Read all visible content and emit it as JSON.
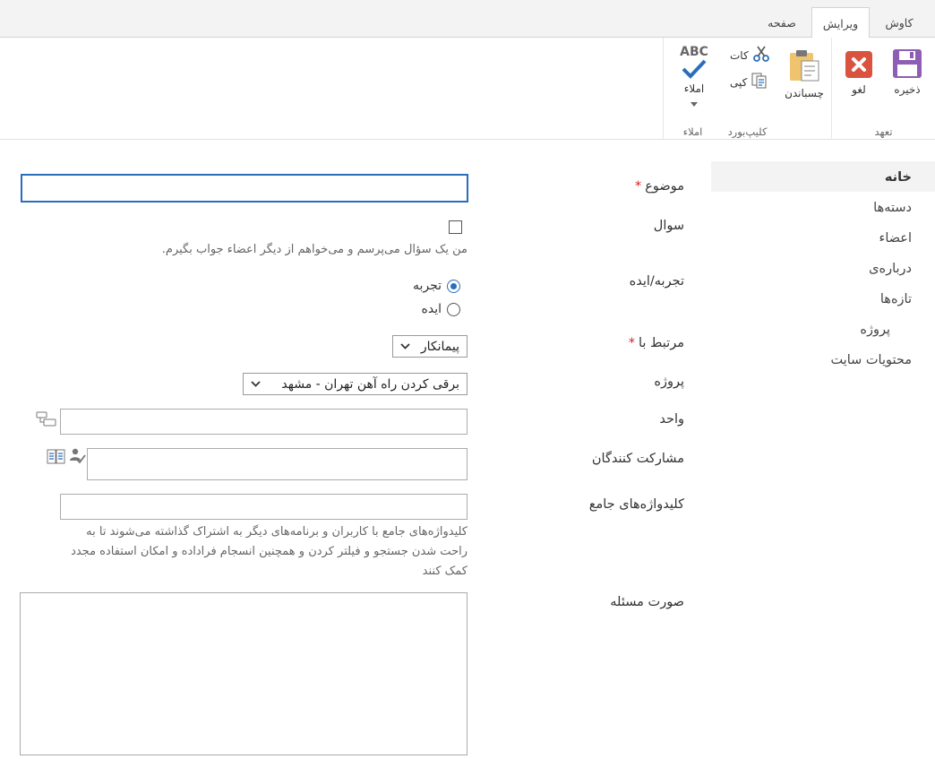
{
  "tabs": [
    {
      "label": "کاوش",
      "active": false
    },
    {
      "label": "ویرایش",
      "active": true
    },
    {
      "label": "صفحه",
      "active": false
    }
  ],
  "ribbon": {
    "commit": {
      "group_label": "تعهد",
      "save_label": "ذخیره",
      "cancel_label": "لغو"
    },
    "clipboard": {
      "group_label": "کلیپ‌بورد",
      "paste_label": "چسباندن",
      "cut_label": "کات",
      "copy_label": "کپی"
    },
    "spelling": {
      "group_label": "املاء",
      "button_label": "املاء",
      "icon_text": "ABC"
    }
  },
  "nav": [
    {
      "label": "خانه",
      "active": true
    },
    {
      "label": "دسته‌ها",
      "active": false
    },
    {
      "label": "اعضاء",
      "active": false
    },
    {
      "label": "درباره‌ی",
      "active": false
    },
    {
      "label": "تازه‌ها",
      "active": false
    },
    {
      "label": "پروژه",
      "active": false,
      "sub": true
    },
    {
      "label": "محتویات سایت",
      "active": false
    }
  ],
  "form": {
    "subject": {
      "label": "موضوع",
      "required_mark": "*",
      "value": ""
    },
    "question": {
      "label": "سوال",
      "checked": false,
      "hint": "من یک سؤال می‌پرسم و می‌خواهم از دیگر اعضاء جواب بگیرم."
    },
    "experience": {
      "label": "تجربه/ایده",
      "options": [
        "تجربه",
        "ایده"
      ],
      "selected": "تجربه"
    },
    "related": {
      "label": "مرتبط با",
      "required_mark": "*",
      "value": "پیمانکار"
    },
    "project": {
      "label": "پروژه",
      "value": "برقی کردن راه آهن تهران - مشهد"
    },
    "unit": {
      "label": "واحد",
      "value": ""
    },
    "participants": {
      "label": "مشارکت کنندگان",
      "value": ""
    },
    "keywords": {
      "label": "کلیدواژه‌های جامع",
      "value": "",
      "hint_line1": "کلیدواژه‌های جامع با کاربران و برنامه‌های دیگر به اشتراک گذاشته می‌شوند تا به",
      "hint_line2": "راحت شدن جستجو و فیلتر کردن و همچنین انسجام فراداده و امکان استفاده مجدد",
      "hint_line3": "کمک کنند"
    },
    "problem": {
      "label": "صورت مسئله",
      "value": ""
    }
  },
  "colors": {
    "accent": "#2a6ebb",
    "save": "#8e5db5",
    "cancel": "#d9533f",
    "required": "#cc2222",
    "spelling_check": "#2a6ebb"
  }
}
